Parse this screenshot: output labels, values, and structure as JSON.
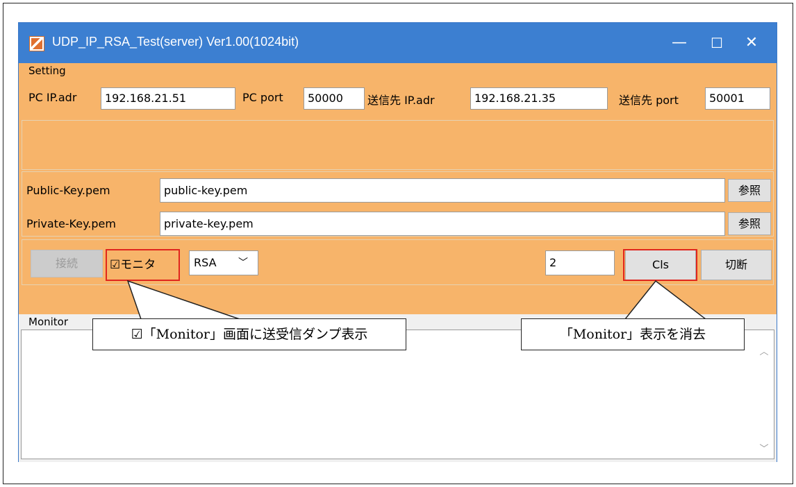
{
  "window": {
    "title": "UDP_IP_RSA_Test(server) Ver1.00(1024bit)",
    "controls": {
      "minimize": "—",
      "maximize": "☐",
      "close": "✕"
    }
  },
  "setting": {
    "group_label": "Setting",
    "pc_ip_label": "PC IP.adr",
    "pc_ip_value": "192.168.21.51",
    "pc_port_label": "PC port",
    "pc_port_value": "50000",
    "dest_ip_label": "送信先 IP.adr",
    "dest_ip_value": "192.168.21.35",
    "dest_port_label": "送信先 port",
    "dest_port_value": "50001"
  },
  "keys": {
    "public_label": "Public-Key.pem",
    "public_value": "public-key.pem",
    "private_label": "Private-Key.pem",
    "private_value": "private-key.pem",
    "browse_label": "参照"
  },
  "controls": {
    "connect_label": "接続",
    "monitor_check_glyph": "☑",
    "monitor_check_label": "モニタ",
    "mode_value": "RSA",
    "mode_arrow": "﹀",
    "count_value": "2",
    "cls_label": "Cls",
    "disconnect_label": "切断"
  },
  "monitor": {
    "group_label": "Monitor",
    "scroll_up": "︿",
    "scroll_down": "﹀"
  },
  "annotations": {
    "left": "☑「Monitor」画面に送受信ダンプ表示",
    "right": "「Monitor」表示を消去"
  },
  "colors": {
    "titlebar": "#3c7fd1",
    "panel": "#f7b46a",
    "highlight": "#e0261e"
  }
}
